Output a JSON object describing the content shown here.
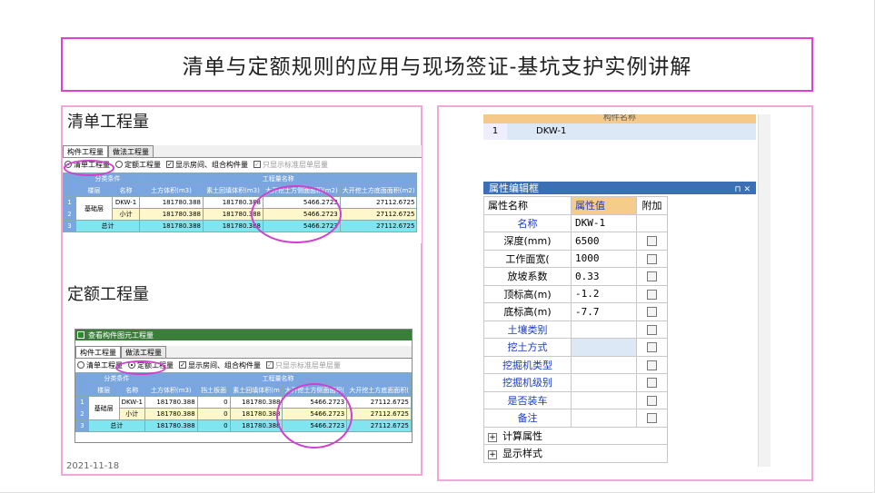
{
  "slide": {
    "title": "清单与定额规则的应用与现场签证-基坑支护实例讲解",
    "date": "2021-11-18",
    "left_label_1": "清单工程量",
    "left_label_2": "定额工程量"
  },
  "qd_panel": {
    "tabs": [
      "构件工程量",
      "做法工程量"
    ],
    "options": {
      "r1": "清单工程量",
      "r2": "定额工程量",
      "c1": "显示房间、组合构件量",
      "c2": "只显示标准层单层量"
    },
    "headers": {
      "group": "分类条件",
      "qty": "工程量名称",
      "floor": "楼层",
      "name": "名称"
    },
    "columns": [
      "土方体积(m3)",
      "素土回填体积(m3)",
      "大开挖土方侧面面积(m2)",
      "大开挖土方底面面积(m2)"
    ],
    "rows": [
      {
        "n": "1",
        "floor": "基础层",
        "name": "DKW-1",
        "vals": [
          "181780.388",
          "181780.388",
          "5466.2723",
          "27112.6725"
        ]
      },
      {
        "n": "2",
        "floor": "",
        "name": "小计",
        "vals": [
          "181780.388",
          "181780.388",
          "5466.2723",
          "27112.6725"
        ]
      },
      {
        "n": "3",
        "floor": "总计",
        "name": "",
        "vals": [
          "181780.388",
          "181780.388",
          "5466.2723",
          "27112.6725"
        ]
      }
    ]
  },
  "de_panel": {
    "window_title": "查看构件图元工程量",
    "tabs": [
      "构件工程量",
      "做法工程量"
    ],
    "options": {
      "r1": "清单工程量",
      "r2": "定额工程量",
      "c1": "显示房间、组合构件量",
      "c2": "只显示标准层单层量"
    },
    "headers": {
      "group": "分类条件",
      "qty": "工程量名称",
      "floor": "楼层",
      "name": "名称"
    },
    "columns": [
      "土方体积(m3)",
      "挡土板面",
      "素土回填体积(m",
      "大开挖土方侧面面积(",
      "大开挖土方底面面积("
    ],
    "rows": [
      {
        "n": "1",
        "floor": "基础层",
        "name": "DKW-1",
        "vals": [
          "181780.388",
          "0",
          "181780.388",
          "5466.2723",
          "27112.6725"
        ]
      },
      {
        "n": "2",
        "floor": "",
        "name": "小计",
        "vals": [
          "181780.388",
          "0",
          "181780.388",
          "5466.2723",
          "27112.6725"
        ]
      },
      {
        "n": "3",
        "floor": "总计",
        "name": "",
        "vals": [
          "181780.388",
          "0",
          "181780.388",
          "5466.2723",
          "27112.6725"
        ]
      }
    ]
  },
  "prop_editor": {
    "top_header": "构件名称",
    "top_row": {
      "n": "1",
      "value": "DKW-1"
    },
    "title": "属性编辑框",
    "pin": "ᅟ⊓ ✕",
    "col_name": "属性名称",
    "col_value": "属性值",
    "col_extra": "附加",
    "rows": [
      {
        "name": "名称",
        "value": "DKW-1",
        "blue": true,
        "chk": false
      },
      {
        "name": "深度(mm)",
        "value": "6500",
        "blue": false,
        "chk": true
      },
      {
        "name": "工作面宽(",
        "value": "1000",
        "blue": false,
        "chk": true
      },
      {
        "name": "放坡系数",
        "value": "0.33",
        "blue": false,
        "chk": true
      },
      {
        "name": "顶标高(m)",
        "value": "-1.2",
        "blue": false,
        "chk": true
      },
      {
        "name": "底标高(m)",
        "value": "-7.7",
        "blue": false,
        "chk": true
      },
      {
        "name": "土壤类别",
        "value": "",
        "blue": true,
        "chk": true
      },
      {
        "name": "挖土方式",
        "value": "",
        "blue": true,
        "chk": true
      },
      {
        "name": "挖掘机类型",
        "value": "",
        "blue": true,
        "chk": true
      },
      {
        "name": "挖掘机级别",
        "value": "",
        "blue": true,
        "chk": true
      },
      {
        "name": "是否装车",
        "value": "",
        "blue": true,
        "chk": true
      },
      {
        "name": "备注",
        "value": "",
        "blue": true,
        "chk": true
      }
    ],
    "groups": [
      "计算属性",
      "显示样式"
    ]
  }
}
